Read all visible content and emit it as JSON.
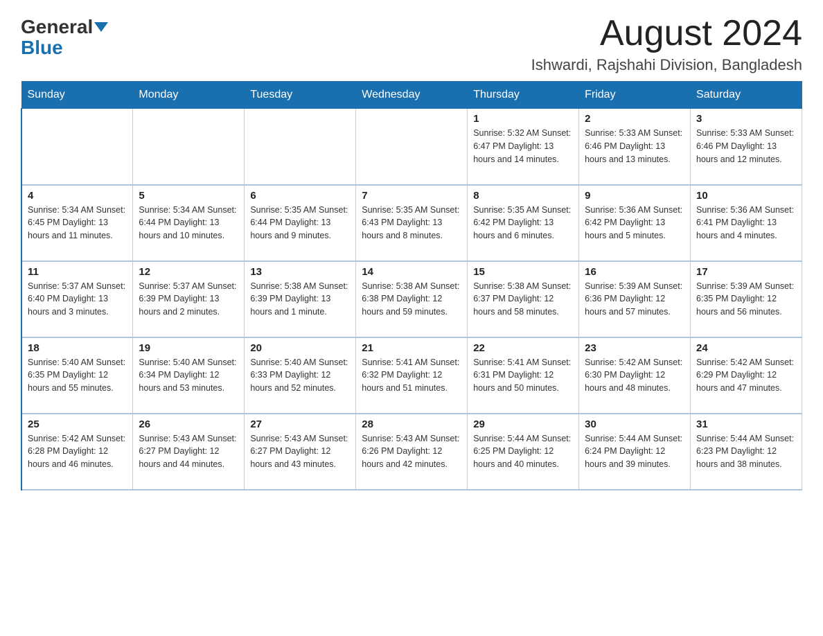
{
  "header": {
    "logo": {
      "general": "General",
      "blue": "Blue"
    },
    "title": "August 2024",
    "location": "Ishwardi, Rajshahi Division, Bangladesh"
  },
  "days_of_week": [
    "Sunday",
    "Monday",
    "Tuesday",
    "Wednesday",
    "Thursday",
    "Friday",
    "Saturday"
  ],
  "weeks": [
    {
      "days": [
        {
          "number": "",
          "info": ""
        },
        {
          "number": "",
          "info": ""
        },
        {
          "number": "",
          "info": ""
        },
        {
          "number": "",
          "info": ""
        },
        {
          "number": "1",
          "info": "Sunrise: 5:32 AM\nSunset: 6:47 PM\nDaylight: 13 hours and 14 minutes."
        },
        {
          "number": "2",
          "info": "Sunrise: 5:33 AM\nSunset: 6:46 PM\nDaylight: 13 hours and 13 minutes."
        },
        {
          "number": "3",
          "info": "Sunrise: 5:33 AM\nSunset: 6:46 PM\nDaylight: 13 hours and 12 minutes."
        }
      ]
    },
    {
      "days": [
        {
          "number": "4",
          "info": "Sunrise: 5:34 AM\nSunset: 6:45 PM\nDaylight: 13 hours and 11 minutes."
        },
        {
          "number": "5",
          "info": "Sunrise: 5:34 AM\nSunset: 6:44 PM\nDaylight: 13 hours and 10 minutes."
        },
        {
          "number": "6",
          "info": "Sunrise: 5:35 AM\nSunset: 6:44 PM\nDaylight: 13 hours and 9 minutes."
        },
        {
          "number": "7",
          "info": "Sunrise: 5:35 AM\nSunset: 6:43 PM\nDaylight: 13 hours and 8 minutes."
        },
        {
          "number": "8",
          "info": "Sunrise: 5:35 AM\nSunset: 6:42 PM\nDaylight: 13 hours and 6 minutes."
        },
        {
          "number": "9",
          "info": "Sunrise: 5:36 AM\nSunset: 6:42 PM\nDaylight: 13 hours and 5 minutes."
        },
        {
          "number": "10",
          "info": "Sunrise: 5:36 AM\nSunset: 6:41 PM\nDaylight: 13 hours and 4 minutes."
        }
      ]
    },
    {
      "days": [
        {
          "number": "11",
          "info": "Sunrise: 5:37 AM\nSunset: 6:40 PM\nDaylight: 13 hours and 3 minutes."
        },
        {
          "number": "12",
          "info": "Sunrise: 5:37 AM\nSunset: 6:39 PM\nDaylight: 13 hours and 2 minutes."
        },
        {
          "number": "13",
          "info": "Sunrise: 5:38 AM\nSunset: 6:39 PM\nDaylight: 13 hours and 1 minute."
        },
        {
          "number": "14",
          "info": "Sunrise: 5:38 AM\nSunset: 6:38 PM\nDaylight: 12 hours and 59 minutes."
        },
        {
          "number": "15",
          "info": "Sunrise: 5:38 AM\nSunset: 6:37 PM\nDaylight: 12 hours and 58 minutes."
        },
        {
          "number": "16",
          "info": "Sunrise: 5:39 AM\nSunset: 6:36 PM\nDaylight: 12 hours and 57 minutes."
        },
        {
          "number": "17",
          "info": "Sunrise: 5:39 AM\nSunset: 6:35 PM\nDaylight: 12 hours and 56 minutes."
        }
      ]
    },
    {
      "days": [
        {
          "number": "18",
          "info": "Sunrise: 5:40 AM\nSunset: 6:35 PM\nDaylight: 12 hours and 55 minutes."
        },
        {
          "number": "19",
          "info": "Sunrise: 5:40 AM\nSunset: 6:34 PM\nDaylight: 12 hours and 53 minutes."
        },
        {
          "number": "20",
          "info": "Sunrise: 5:40 AM\nSunset: 6:33 PM\nDaylight: 12 hours and 52 minutes."
        },
        {
          "number": "21",
          "info": "Sunrise: 5:41 AM\nSunset: 6:32 PM\nDaylight: 12 hours and 51 minutes."
        },
        {
          "number": "22",
          "info": "Sunrise: 5:41 AM\nSunset: 6:31 PM\nDaylight: 12 hours and 50 minutes."
        },
        {
          "number": "23",
          "info": "Sunrise: 5:42 AM\nSunset: 6:30 PM\nDaylight: 12 hours and 48 minutes."
        },
        {
          "number": "24",
          "info": "Sunrise: 5:42 AM\nSunset: 6:29 PM\nDaylight: 12 hours and 47 minutes."
        }
      ]
    },
    {
      "days": [
        {
          "number": "25",
          "info": "Sunrise: 5:42 AM\nSunset: 6:28 PM\nDaylight: 12 hours and 46 minutes."
        },
        {
          "number": "26",
          "info": "Sunrise: 5:43 AM\nSunset: 6:27 PM\nDaylight: 12 hours and 44 minutes."
        },
        {
          "number": "27",
          "info": "Sunrise: 5:43 AM\nSunset: 6:27 PM\nDaylight: 12 hours and 43 minutes."
        },
        {
          "number": "28",
          "info": "Sunrise: 5:43 AM\nSunset: 6:26 PM\nDaylight: 12 hours and 42 minutes."
        },
        {
          "number": "29",
          "info": "Sunrise: 5:44 AM\nSunset: 6:25 PM\nDaylight: 12 hours and 40 minutes."
        },
        {
          "number": "30",
          "info": "Sunrise: 5:44 AM\nSunset: 6:24 PM\nDaylight: 12 hours and 39 minutes."
        },
        {
          "number": "31",
          "info": "Sunrise: 5:44 AM\nSunset: 6:23 PM\nDaylight: 12 hours and 38 minutes."
        }
      ]
    }
  ]
}
